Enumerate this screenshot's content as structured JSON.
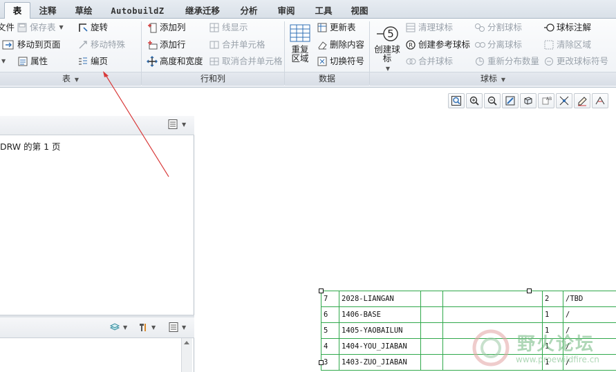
{
  "tabs": [
    {
      "label": "表",
      "active": true
    },
    {
      "label": "注释"
    },
    {
      "label": "草绘"
    },
    {
      "label": "AutobuildZ"
    },
    {
      "label": "继承迁移"
    },
    {
      "label": "分析"
    },
    {
      "label": "审阅"
    },
    {
      "label": "工具"
    },
    {
      "label": "视图"
    }
  ],
  "ribbon": {
    "table_group": {
      "file": "文件",
      "save_table": "保存表",
      "rotate": "旋转",
      "move_to_page": "移动到页面",
      "move_special": "移动特殊",
      "properties": "属性",
      "paginate": "编页",
      "footer": "表"
    },
    "rows_cols_group": {
      "add_column": "添加列",
      "line_display": "线显示",
      "add_row": "添加行",
      "merge_cells": "合并单元格",
      "height_width": "高度和宽度",
      "unmerge_cells": "取消合并单元格",
      "footer": "行和列"
    },
    "data_group": {
      "repeat_region": "重复区域",
      "update_table": "更新表",
      "delete_content": "删除内容",
      "switch_symbol": "切换符号",
      "footer": "数据"
    },
    "balloon_group": {
      "create_balloon": "创建球标",
      "balloon_number": "5",
      "clean_balloons": "清理球标",
      "create_ref_balloon": "创建参考球标",
      "merge_balloons": "合并球标",
      "split_balloons": "分割球标",
      "detach_balloons": "分离球标",
      "redistribute": "重新分布数量",
      "balloon_note": "球标注解",
      "clear_area": "清除区域",
      "change_balloon_symbol": "更改球标符号",
      "footer": "球标"
    }
  },
  "left_panel": {
    "page_text": "DRW 的第 1 页"
  },
  "bom_rows": [
    {
      "idx": "7",
      "name": "2028-LIANGAN",
      "qty": "2",
      "note": "/TBD"
    },
    {
      "idx": "6",
      "name": "1406-BASE",
      "qty": "1",
      "note": "/"
    },
    {
      "idx": "5",
      "name": "1405-YAOBAILUN",
      "qty": "1",
      "note": "/"
    },
    {
      "idx": "4",
      "name": "1404-YOU_JIABAN",
      "qty": "1",
      "note": "/"
    },
    {
      "idx": "3",
      "name": "1403-ZUO_JIABAN",
      "qty": "1",
      "note": "/"
    }
  ],
  "watermark": {
    "title": "野火论坛",
    "url": "www.proewildfire.cn"
  },
  "colors": {
    "accent": "#2f6fb5",
    "table_line": "#2fa84a",
    "arrow": "#d93a3a"
  }
}
